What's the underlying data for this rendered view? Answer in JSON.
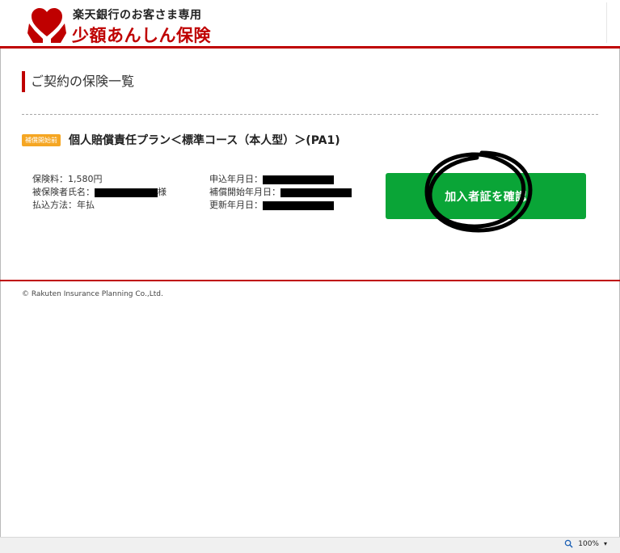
{
  "header": {
    "brand_line1": "楽天銀行のお客さま専用",
    "brand_line2": "少額あんしん保険"
  },
  "main": {
    "section_title": "ご契約の保険一覧",
    "contract": {
      "badge": "補償開始前",
      "plan_title": "個人賠償責任プラン＜標準コース（本人型）＞(PA1)",
      "left": {
        "premium": "保険料：1,580円",
        "insured_label": "被保険者氏名：",
        "insured_suffix": "様",
        "payment": "払込方法：年払"
      },
      "right": {
        "apply_date_label": "申込年月日：",
        "start_date_label": "補償開始年月日：",
        "renew_date_label": "更新年月日："
      },
      "button_label": "加入者証を確認"
    }
  },
  "footer": {
    "copyright": "© Rakuten Insurance Planning Co.,Ltd."
  },
  "statusbar": {
    "zoom": "100%"
  },
  "colors": {
    "brand_red": "#bf0000",
    "button_green": "#0aa537",
    "badge_orange": "#f5a623"
  }
}
